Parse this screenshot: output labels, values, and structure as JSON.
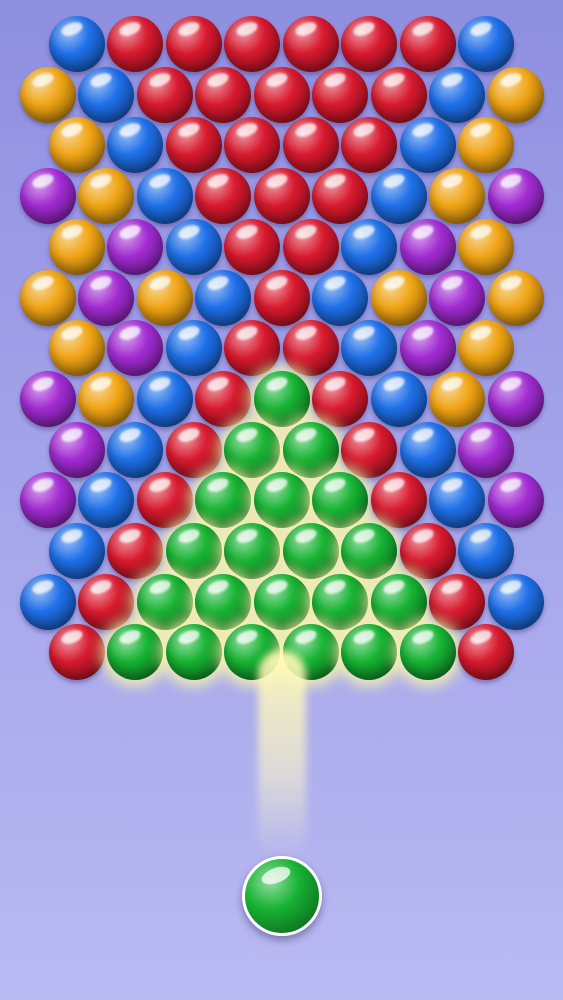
{
  "colors": {
    "blue": "#1e6fe8",
    "red": "#d8192e",
    "gold": "#f0a414",
    "purple": "#a12bd2",
    "green": "#16b332",
    "background": "#a3a3ea"
  },
  "board": {
    "rows": [
      [
        "blue",
        "red",
        "red",
        "red",
        "red",
        "red",
        "red",
        "blue"
      ],
      [
        "gold",
        "blue",
        "red",
        "red",
        "red",
        "red",
        "red",
        "blue",
        "gold"
      ],
      [
        "gold",
        "blue",
        "red",
        "red",
        "red",
        "red",
        "blue",
        "gold"
      ],
      [
        "purple",
        "gold",
        "blue",
        "red",
        "red",
        "red",
        "blue",
        "gold",
        "purple"
      ],
      [
        "gold",
        "purple",
        "blue",
        "red",
        "red",
        "blue",
        "purple",
        "gold"
      ],
      [
        "gold",
        "purple",
        "gold",
        "blue",
        "red",
        "blue",
        "gold",
        "purple",
        "gold"
      ],
      [
        "gold",
        "purple",
        "blue",
        "red",
        "red",
        "blue",
        "purple",
        "gold"
      ],
      [
        "purple",
        "gold",
        "blue",
        "red",
        "green",
        "red",
        "blue",
        "gold",
        "purple"
      ],
      [
        "purple",
        "blue",
        "red",
        "green",
        "green",
        "red",
        "blue",
        "purple"
      ],
      [
        "purple",
        "blue",
        "red",
        "green",
        "green",
        "green",
        "red",
        "blue",
        "purple"
      ],
      [
        "blue",
        "red",
        "green",
        "green",
        "green",
        "green",
        "red",
        "blue"
      ],
      [
        "blue",
        "red",
        "green",
        "green",
        "green",
        "green",
        "green",
        "red",
        "blue"
      ],
      [
        "red",
        "green",
        "green",
        "green",
        "green",
        "green",
        "green",
        "red"
      ]
    ],
    "highlighted_color": "green"
  },
  "shooter": {
    "color": "green"
  }
}
